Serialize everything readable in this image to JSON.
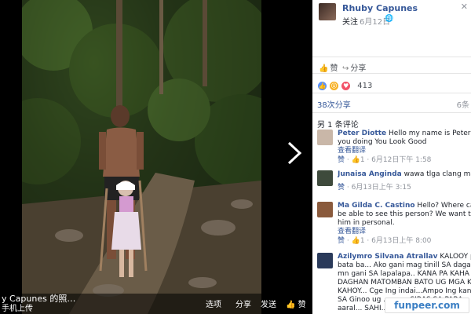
{
  "caption": {
    "title": "y Capunes 的照…",
    "sub": "手机上传",
    "actions": {
      "tag": "选项",
      "share": "分享",
      "send": "发送",
      "like": "赞"
    }
  },
  "post": {
    "poster_name": "Rhuby Capunes",
    "follow": "关注",
    "date": "6月12日",
    "close": "✕"
  },
  "actions": {
    "like": "赞",
    "share": "分享"
  },
  "reactions": {
    "count": "413"
  },
  "shares": {
    "label": "38次分享",
    "right": "6条"
  },
  "comments_count": "另 1 条评论",
  "comments": [
    {
      "name": "Peter Diotte",
      "text": "Hello my name is Peter How are",
      "line2": "you doing You Look Good",
      "translate": "查看翻译",
      "like": "赞",
      "thumbs": "1",
      "time": "6月12日下午 1:58",
      "avatar_color": "#c9b7a8"
    },
    {
      "name": "Junaisa Anginda",
      "text": "wawa tlga clang mag Am",
      "line2": "",
      "translate": "",
      "like": "赞",
      "thumbs": "",
      "time": "6月13日上午 3:15",
      "avatar_color": "#3e4a3c"
    },
    {
      "name": "Ma Gilda C. Castino",
      "text": "Hello? Where can we",
      "line2": "be able to see this person? We want to meet",
      "line3": "him in personal.",
      "translate": "查看翻译",
      "like": "赞",
      "thumbs": "1",
      "time": "6月13日上午 8:00",
      "avatar_color": "#8a5a3c"
    },
    {
      "name": "Azilymro Silvana Atrallav",
      "text": "KALOOY pod SA",
      "line2": "bata ba... Ako gani mag tinill SA dagat SAKO",
      "line3": "mn gani SA lapalapa.. KANA PA KAHA",
      "line4": "DAGHAN MATOMBAN BATO UG MGA KAHOY",
      "line5": "KAHOY... Cge Ing indai...Ampo Ing kanunay",
      "line6": "SA Ginoo ug ... ... ... SIRAS SA PARA...",
      "line7": "aaral... SAHI...",
      "avatar_color": "#2a3a5a"
    }
  ],
  "watermark": "funpeer.com",
  "colors": {
    "link": "#365899",
    "like_reaction": "#5890ff",
    "wow_reaction": "#f7b125",
    "love_reaction": "#f25268"
  }
}
